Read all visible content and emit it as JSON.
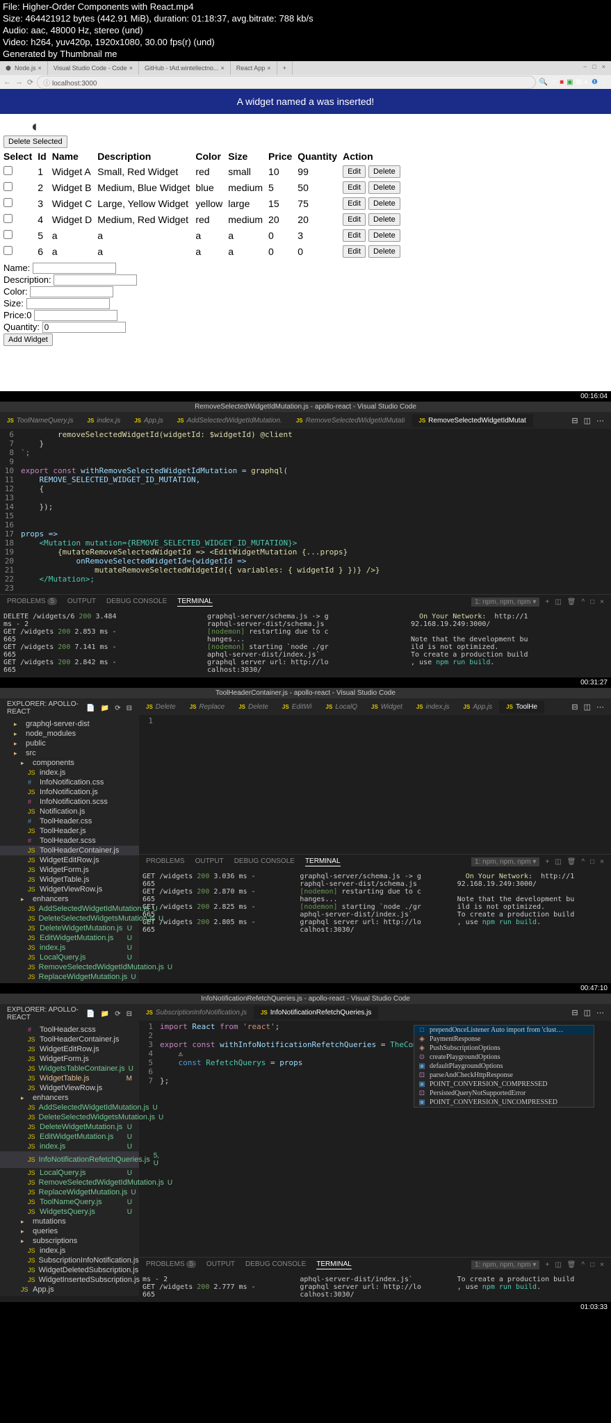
{
  "file_info": {
    "filename": "File: Higher-Order Components with React.mp4",
    "size": "Size: 464421912 bytes (442.91 MiB), duration: 01:18:37, avg.bitrate: 788 kb/s",
    "audio": "Audio: aac, 48000 Hz, stereo (und)",
    "video": "Video: h264, yuv420p, 1920x1080, 30.00 fps(r) (und)",
    "generated": "Generated by Thumbnail me"
  },
  "browser": {
    "tabs": [
      "Node.js",
      "Visual Studio Code - Code",
      "GitHub - tAd.wintellectno...",
      "React App"
    ],
    "url": "localhost:3000",
    "banner": "A widget named a was inserted!",
    "delete_selected": "Delete Selected",
    "headers": [
      "Select",
      "Id",
      "Name",
      "Description",
      "Color",
      "Size",
      "Price",
      "Quantity",
      "Action"
    ],
    "rows": [
      {
        "id": "1",
        "name": "Widget A",
        "desc": "Small, Red Widget",
        "color": "red",
        "size": "small",
        "price": "10",
        "qty": "99"
      },
      {
        "id": "2",
        "name": "Widget B",
        "desc": "Medium, Blue Widget",
        "color": "blue",
        "size": "medium",
        "price": "5",
        "qty": "50"
      },
      {
        "id": "3",
        "name": "Widget C",
        "desc": "Large, Yellow Widget",
        "color": "yellow",
        "size": "large",
        "price": "15",
        "qty": "75"
      },
      {
        "id": "4",
        "name": "Widget D",
        "desc": "Medium, Red Widget",
        "color": "red",
        "size": "medium",
        "price": "20",
        "qty": "20"
      },
      {
        "id": "5",
        "name": "a",
        "desc": "a",
        "color": "a",
        "size": "a",
        "price": "0",
        "qty": "3"
      },
      {
        "id": "6",
        "name": "a",
        "desc": "a",
        "color": "a",
        "size": "a",
        "price": "0",
        "qty": "0"
      }
    ],
    "edit_btn": "Edit",
    "delete_btn": "Delete",
    "form": {
      "name_lbl": "Name:",
      "desc_lbl": "Description:",
      "color_lbl": "Color:",
      "size_lbl": "Size:",
      "price_lbl": "Price:",
      "qty_lbl": "Quantity:",
      "price_val": "0",
      "qty_val": "0",
      "add_btn": "Add Widget"
    }
  },
  "timestamps": {
    "t1": "00:16:04",
    "t2": "00:31:27",
    "t3": "00:47:10",
    "t4": "01:03:33"
  },
  "vscode1": {
    "title": "RemoveSelectedWidgetIdMutation.js - apollo-react - Visual Studio Code",
    "tabs": [
      "ToolNameQuery.js",
      "index.js",
      "App.js",
      "AddSelectedWidgetIdMutation.",
      "RemoveSelectedWidgetIdMutati",
      "RemoveSelectedWidgetIdMutat"
    ],
    "code": {
      "l6": "        removeSelectedWidgetId(widgetId: $widgetId) @client",
      "l7": "    }",
      "l8": "`;",
      "l10_a": "export const",
      "l10_b": " withRemoveSelectedWidgetIdMutation = ",
      "l10_c": "graphql",
      "l10_d": "(",
      "l11": "    REMOVE_SELECTED_WIDGET_ID_MUTATION,",
      "l12": "    {",
      "l13": " ",
      "l14": "    });",
      "l17": "props =>",
      "l18": "    <Mutation mutation={REMOVE_SELECTED_WIDGET_ID_MUTATION}>",
      "l19": "        {mutateRemoveSelectedWidgetId => <EditWidgetMutation {...props}",
      "l20": "            onRemoveSelectedWidgetId={widgetId =>",
      "l21": "                mutateRemoveSelectedWidgetId({ variables: { widgetId } })} />}",
      "l22": "    </Mutation>;"
    },
    "terminal": {
      "tabs": [
        "PROBLEMS",
        "OUTPUT",
        "DEBUG CONSOLE",
        "TERMINAL"
      ],
      "dropdown": "1: npm, npm, npm",
      "count": "5",
      "pane1": "DELETE /widgets/6 200 3.484\nms - 2\nGET /widgets 200 2.853 ms -\n665\nGET /widgets 200 7.141 ms -\n665\nGET /widgets 200 2.842 ms -\n665",
      "pane2": "graphql-server/schema.js -> g\nraphql-server-dist/schema.js\n[nodemon] restarting due to c\nhanges...\n[nodemon] starting `node ./gr\naphql-server-dist/index.js`\ngraphql server url: http://lo\ncalhost:3030/",
      "pane3": "  On Your Network:  http://1\n92.168.19.249:3000/\n\nNote that the development bu\nild is not optimized.\nTo create a production build\n, use npm run build."
    }
  },
  "vscode2": {
    "title": "ToolHeaderContainer.js - apollo-react - Visual Studio Code",
    "explorer_title": "EXPLORER: APOLLO-REACT",
    "tree": [
      "graphql-server-dist",
      "node_modules",
      "public",
      "src",
      "components",
      "index.js",
      "InfoNotification.css",
      "InfoNotification.js",
      "InfoNotification.scss",
      "Notification.js",
      "ToolHeader.css",
      "ToolHeader.js",
      "ToolHeader.scss",
      "ToolHeaderContainer.js",
      "WidgetEditRow.js",
      "WidgetForm.js",
      "WidgetTable.js",
      "WidgetViewRow.js",
      "enhancers",
      "AddSelectedWidgetIdMutation.js",
      "DeleteSelectedWidgetsMutation.js",
      "DeleteWidgetMutation.js",
      "EditWidgetMutation.js",
      "index.js",
      "LocalQuery.js",
      "RemoveSelectedWidgetIdMutation.js",
      "ReplaceWidgetMutation.js"
    ],
    "tabs": [
      "Delete",
      "Replace",
      "Delete",
      "EditWi",
      "LocalQ",
      "Widget",
      "index.js",
      "App.js",
      "ToolHe"
    ],
    "terminal": {
      "pane1": "GET /widgets 200 3.036 ms -\n665\nGET /widgets 200 2.870 ms -\n665\nGET /widgets 200 2.825 ms -\n665\nGET /widgets 200 2.805 ms -\n665",
      "pane2": "graphql-server/schema.js -> g\nraphql-server-dist/schema.js\n[nodemon] restarting due to c\nhanges...\n[nodemon] starting `node ./gr\naphql-server-dist/index.js`\ngraphql server url: http://lo\ncalhost:3030/",
      "pane3": "  On Your Network:  http://1\n92.168.19.249:3000/\n\nNote that the development bu\nild is not optimized.\nTo create a production build\n, use npm run build."
    }
  },
  "vscode3": {
    "title": "InfoNotificationRefetchQueries.js - apollo-react - Visual Studio Code",
    "tabs": [
      "SubscriptionInfoNotification.js",
      "InfoNotificationRefetchQueries.js"
    ],
    "tree": [
      "ToolHeader.scss",
      "ToolHeaderContainer.js",
      "WidgetEditRow.js",
      "WidgetForm.js",
      "WidgetsTableContainer.js",
      "WidgetTable.js",
      "WidgetViewRow.js",
      "enhancers",
      "AddSelectedWidgetIdMutation.js",
      "DeleteSelectedWidgetsMutation.js",
      "DeleteWidgetMutation.js",
      "EditWidgetMutation.js",
      "index.js",
      "InfoNotificationRefetchQueries.js",
      "LocalQuery.js",
      "RemoveSelectedWidgetIdMutation.js",
      "ReplaceWidgetMutation.js",
      "ToolNameQuery.js",
      "WidgetsQuery.js",
      "mutations",
      "queries",
      "subscriptions",
      "index.js",
      "SubscriptionInfoNotification.js",
      "WidgetDeletedSubscription.js",
      "WidgetInsertedSubscription.js",
      "App.js"
    ],
    "code": {
      "l1": "import React from 'react';",
      "l3": "export const withInfoNotificationRefetchQueries = TheComponent => {",
      "l5": "    const RefetchQuerys = props",
      "l7": "};"
    },
    "autocomplete": [
      "prependOnceListener  Auto import from 'clust…",
      "PaymentResponse",
      "PushSubscriptionOptions",
      "createPlaygroundOptions",
      "defaultPlaygroundOptions",
      "parseAndCheckHttpResponse",
      "POINT_CONVERSION_COMPRESSED",
      "PersistedQueryNotSupportedError",
      "POINT_CONVERSION_UNCOMPRESSED"
    ],
    "terminal": {
      "pane1": "ms - 2\nGET /widgets 200 2.777 ms -\n665",
      "pane2": "aphql-server-dist/index.js`\ngraphql server url: http://lo\ncalhost:3030/",
      "pane3": "To create a production build\n, use npm run build."
    }
  }
}
